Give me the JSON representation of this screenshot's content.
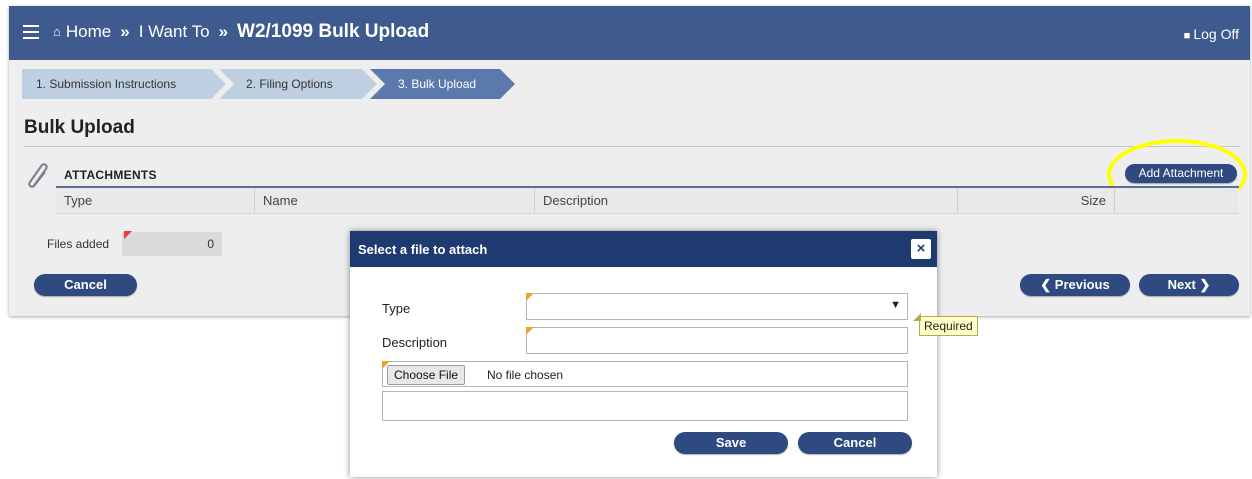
{
  "header": {
    "breadcrumb": [
      "Home",
      "I Want To",
      "W2/1099 Bulk Upload"
    ],
    "separator": "»",
    "logoff": "Log Off",
    "bg_color": "#3f5a8e"
  },
  "wizard": {
    "steps": [
      {
        "label": "1. Submission Instructions",
        "state": "done"
      },
      {
        "label": "2. Filing Options",
        "state": "done"
      },
      {
        "label": "3. Bulk Upload",
        "state": "active"
      }
    ]
  },
  "page": {
    "title": "Bulk Upload"
  },
  "attachments": {
    "label": "ATTACHMENTS",
    "add_button": "Add Attachment",
    "columns": [
      "Type",
      "Name",
      "Description",
      "Size"
    ]
  },
  "files_added": {
    "label": "Files added",
    "value": "0"
  },
  "buttons": {
    "cancel": "Cancel",
    "previous": "Previous",
    "next": "Next"
  },
  "modal": {
    "title": "Select a file to attach",
    "close": "×",
    "type_label": "Type",
    "type_value": "",
    "description_label": "Description",
    "description_value": "",
    "choose_file": "Choose File",
    "no_file": "No file chosen",
    "tooltip": "Required",
    "save": "Save",
    "cancel": "Cancel"
  },
  "colors": {
    "accent": "#2e4a80",
    "highlight": "#ffff00",
    "required_marker": "#f2a22c"
  }
}
